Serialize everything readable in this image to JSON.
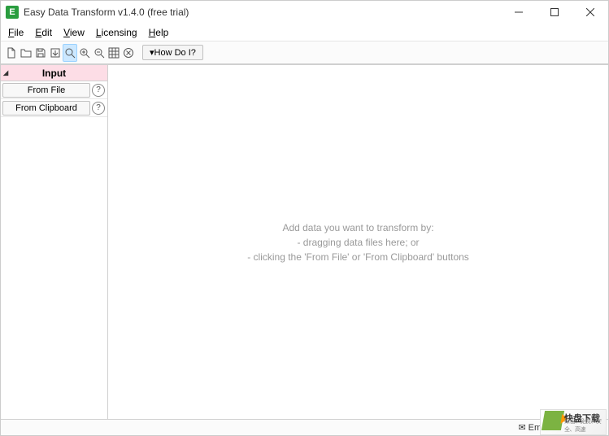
{
  "window": {
    "title": "Easy Data Transform v1.4.0 (free trial)",
    "icon_letter": "E"
  },
  "menubar": {
    "items": [
      {
        "label": "File",
        "ul": "F",
        "rest": "ile"
      },
      {
        "label": "Edit",
        "ul": "E",
        "rest": "dit"
      },
      {
        "label": "View",
        "ul": "V",
        "rest": "iew"
      },
      {
        "label": "Licensing",
        "ul": "L",
        "rest": "icensing"
      },
      {
        "label": "Help",
        "ul": "H",
        "rest": "elp"
      }
    ]
  },
  "toolbar": {
    "howdoi_label": "▾How Do I?"
  },
  "sidebar": {
    "header": "Input",
    "from_file": "From File",
    "from_clipboard": "From Clipboard"
  },
  "canvas": {
    "line1": "Add data you want to transform by:",
    "line2": "- dragging data files here; or",
    "line3": "- clicking the 'From File' or 'From Clipboard' buttons"
  },
  "statusbar": {
    "email": "Email us questions"
  },
  "watermark": {
    "title": "快盘下载",
    "sub": "绿色、免费、安全、高速"
  }
}
